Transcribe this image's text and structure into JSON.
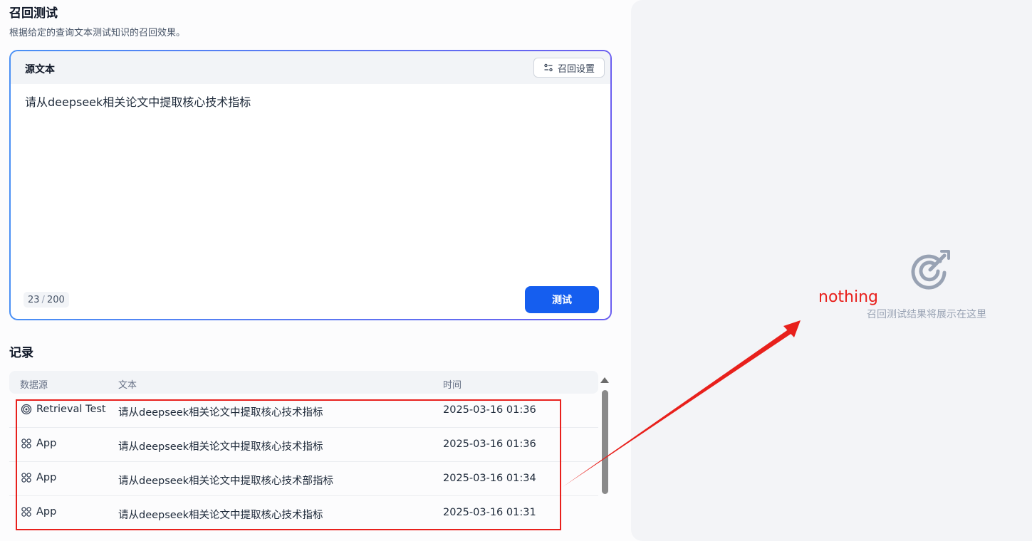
{
  "page": {
    "title": "召回测试",
    "description": "根据给定的查询文本测试知识的召回效果。"
  },
  "editor": {
    "label": "源文本",
    "settings_button": "召回设置",
    "text": "请从deepseek相关论文中提取核心技术指标",
    "count": "23",
    "count_sep": "/",
    "max": "200",
    "test_button": "测试"
  },
  "records": {
    "title": "记录",
    "columns": {
      "source": "数据源",
      "text": "文本",
      "time": "时间"
    },
    "rows": [
      {
        "source": "Retrieval Test",
        "icon": "target-icon",
        "text": "请从deepseek相关论文中提取核心技术指标",
        "time": "2025-03-16 01:36"
      },
      {
        "source": "App",
        "icon": "app-grid-icon",
        "text": "请从deepseek相关论文中提取核心技术指标",
        "time": "2025-03-16 01:36"
      },
      {
        "source": "App",
        "icon": "app-grid-icon",
        "text": "请从deepseek相关论文中提取核心技术部指标",
        "time": "2025-03-16 01:34"
      },
      {
        "source": "App",
        "icon": "app-grid-icon",
        "text": "请从deepseek相关论文中提取核心技术指标",
        "time": "2025-03-16 01:31"
      }
    ]
  },
  "results": {
    "empty_text": "召回测试结果将展示在这里"
  },
  "annotation": {
    "text": "nothing",
    "color": "#e8201c"
  },
  "colors": {
    "accent": "#155eef",
    "annotation": "#e8201c"
  }
}
